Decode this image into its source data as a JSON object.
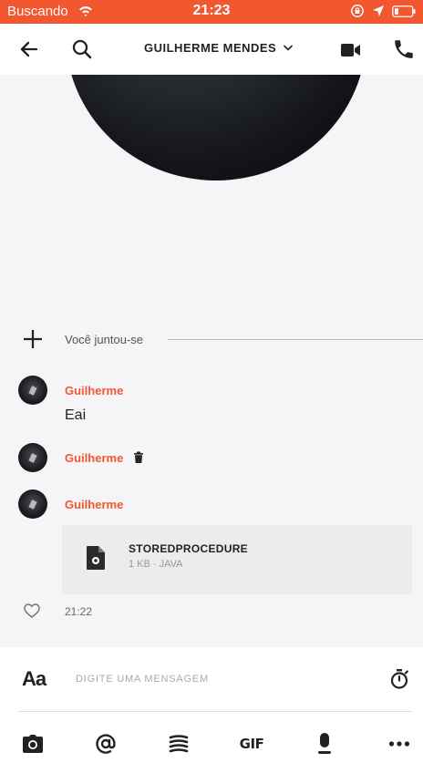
{
  "status_bar": {
    "carrier": "Buscando",
    "time": "21:23"
  },
  "header": {
    "title": "GUILHERME MENDES"
  },
  "conversation": {
    "join_text": "Você juntou-se",
    "messages": [
      {
        "sender": "Guilherme",
        "text": "Eai"
      },
      {
        "sender": "Guilherme",
        "deleted": true
      },
      {
        "sender": "Guilherme",
        "attachment": {
          "name": "STOREDPROCEDURE",
          "meta": "1 KB · JAVA"
        }
      }
    ],
    "last_time": "21:22"
  },
  "composer": {
    "aa_label": "Aa",
    "placeholder": "DIGITE UMA MENSAGEM",
    "gif_label": "GIF"
  },
  "colors": {
    "accent": "#f2572f",
    "background": "#f5f5f7"
  },
  "icons": [
    "back-arrow-icon",
    "search-icon",
    "chevron-down-icon",
    "video-camera-icon",
    "phone-icon",
    "plus-icon",
    "trash-icon",
    "file-icon",
    "heart-icon",
    "timer-icon",
    "camera-icon",
    "mention-icon",
    "sticker-icon",
    "gif-icon",
    "microphone-icon",
    "more-icon"
  ]
}
